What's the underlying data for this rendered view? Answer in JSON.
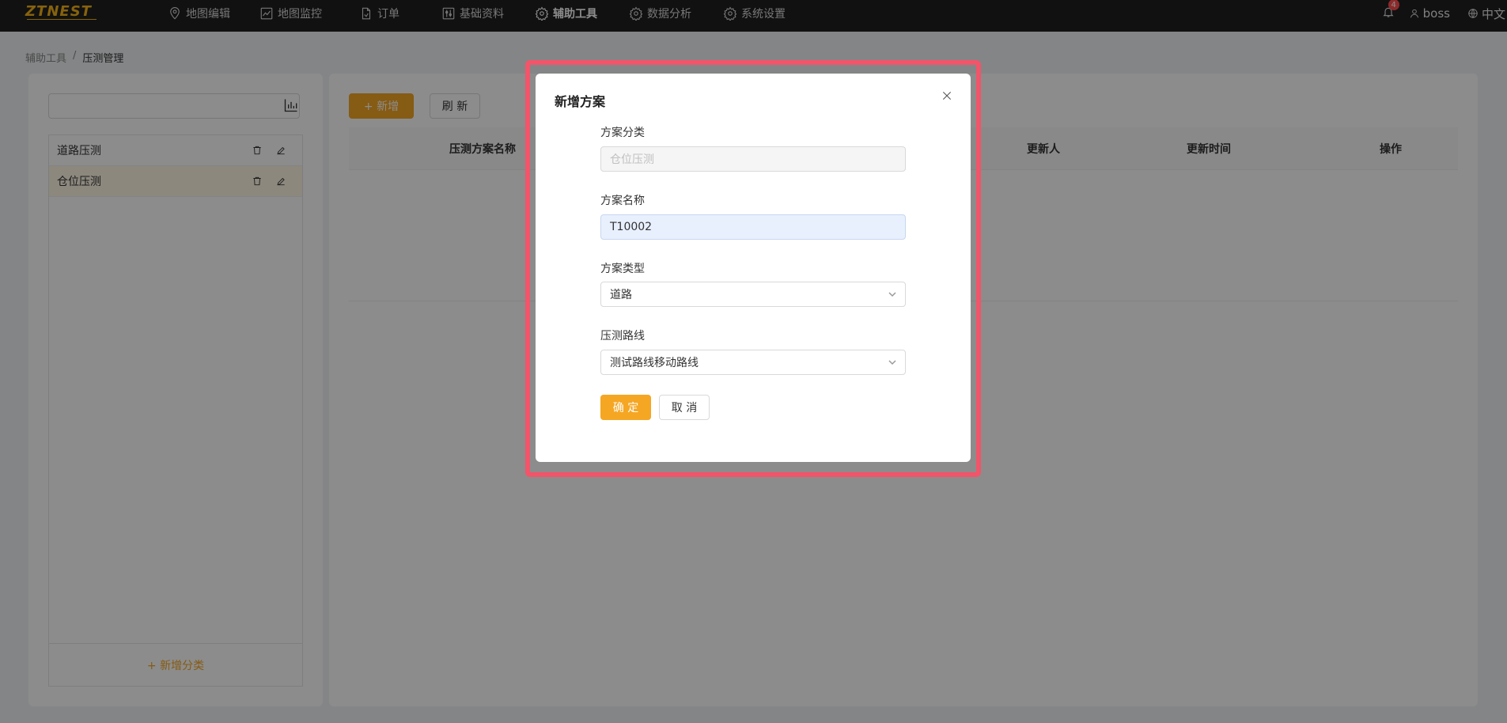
{
  "topbar": {
    "logo": "ZTNEST",
    "nav": [
      {
        "label": "地图编辑",
        "icon": "location-pin-icon"
      },
      {
        "label": "地图监控",
        "icon": "line-chart-icon"
      },
      {
        "label": "订单",
        "icon": "document-icon"
      },
      {
        "label": "基础资料",
        "icon": "sliders-icon"
      },
      {
        "label": "辅助工具",
        "icon": "gear-icon",
        "active": true
      },
      {
        "label": "数据分析",
        "icon": "gear-icon"
      },
      {
        "label": "系统设置",
        "icon": "gear-icon"
      }
    ],
    "notification_count": "4",
    "username": "boss",
    "language": "中文"
  },
  "breadcrumb": {
    "parent": "辅助工具",
    "separator": "/",
    "current": "压测管理"
  },
  "left_panel": {
    "search_value": "",
    "categories": [
      {
        "label": "道路压测",
        "selected": false
      },
      {
        "label": "仓位压测",
        "selected": true
      }
    ],
    "add_category_label": "+ 新增分类"
  },
  "right_panel": {
    "add_label": "+ 新增",
    "refresh_label": "刷 新",
    "columns": [
      "压测方案名称",
      "更新人",
      "更新时间",
      "操作"
    ]
  },
  "modal": {
    "title": "新增方案",
    "fields": {
      "category": {
        "label": "方案分类",
        "value": "仓位压测"
      },
      "name": {
        "label": "方案名称",
        "value": "T10002"
      },
      "type": {
        "label": "方案类型",
        "value": "道路"
      },
      "route": {
        "label": "压测路线",
        "value": "测试路线移动路线"
      }
    },
    "ok_label": "确 定",
    "cancel_label": "取 消"
  },
  "colors": {
    "accent": "#f5a623",
    "highlight": "#f2546a",
    "topbar": "#1f1f1f"
  }
}
